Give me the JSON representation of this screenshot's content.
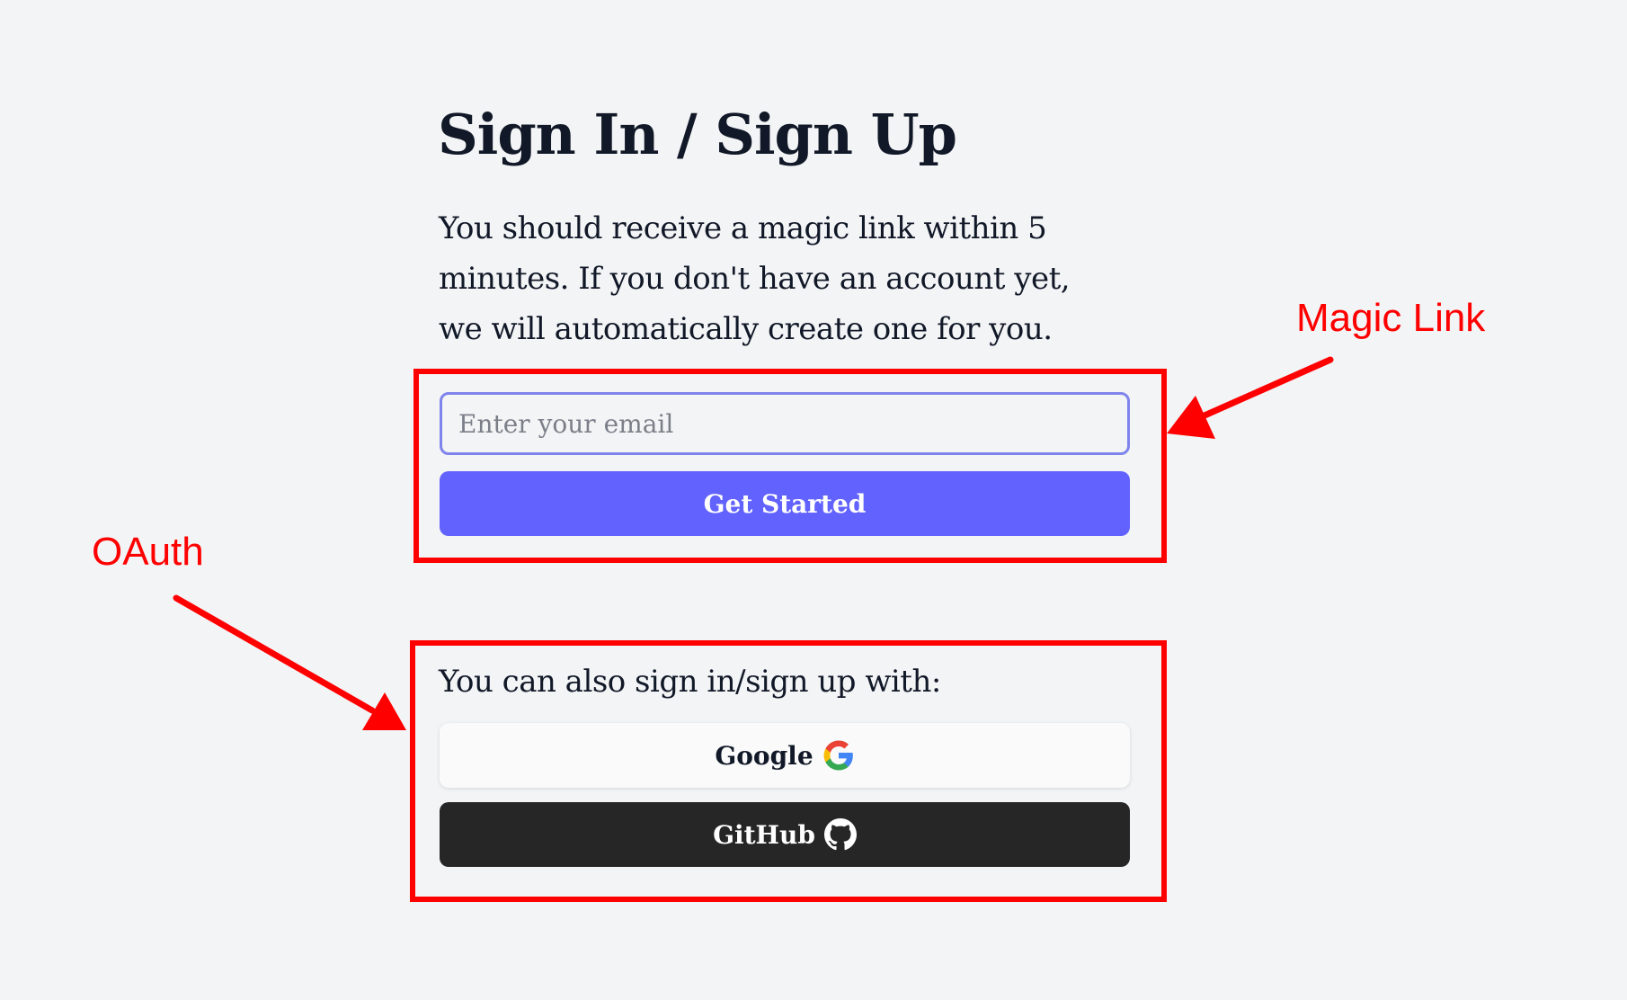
{
  "auth": {
    "title": "Sign In / Sign Up",
    "description": "You should receive a magic link within 5 minutes. If you don't have an account yet, we will automatically create one for you.",
    "email_placeholder": "Enter your email",
    "email_value": "",
    "submit_label": "Get Started",
    "oauth_intro": "You can also sign in/sign up with:",
    "providers": [
      {
        "label": "Google",
        "icon": "google-icon",
        "background": "#fafafa"
      },
      {
        "label": "GitHub",
        "icon": "github-icon",
        "background": "#262626"
      }
    ]
  },
  "annotations": {
    "magic_link_label": "Magic Link",
    "oauth_label": "OAuth",
    "color": "#ff0000"
  },
  "colors": {
    "primary": "#6262fe",
    "input_border": "#7f84ec",
    "text": "#111827",
    "background": "#f3f4f6"
  }
}
